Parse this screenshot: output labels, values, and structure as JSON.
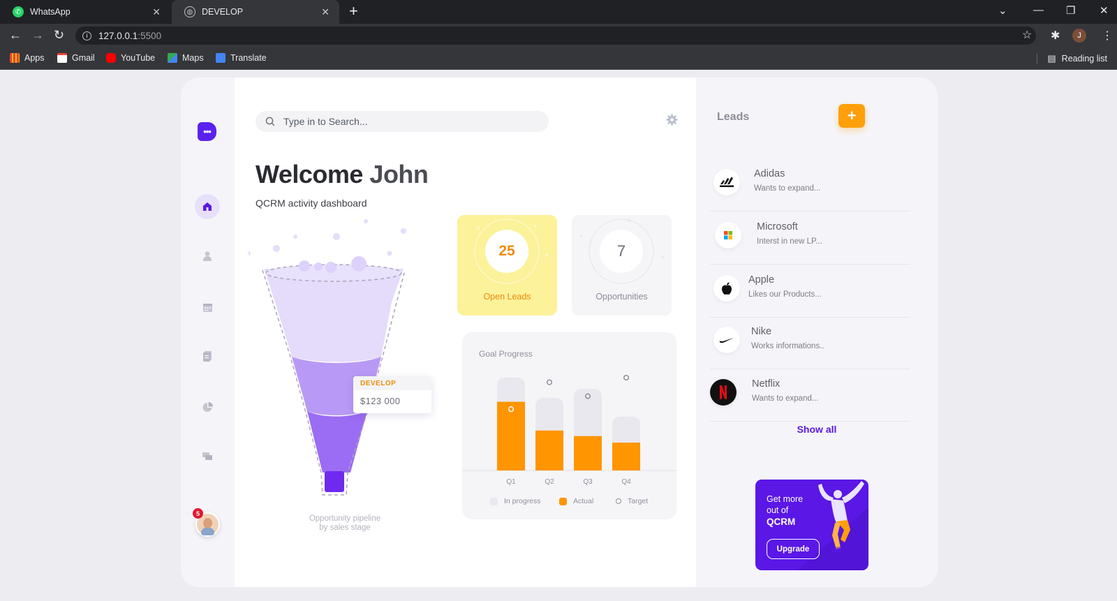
{
  "browser": {
    "tabs": [
      {
        "title": "WhatsApp",
        "active": false
      },
      {
        "title": "DEVELOP",
        "active": true
      }
    ],
    "address": {
      "host": "127.0.0.1",
      "port": ":5500"
    },
    "bookmarks": [
      "Apps",
      "Gmail",
      "YouTube",
      "Maps",
      "Translate"
    ],
    "reading_list": "Reading list",
    "profile_initial": "J"
  },
  "sidebar": {
    "items": [
      "home",
      "contacts",
      "calendar",
      "documents",
      "reports",
      "messages"
    ],
    "notification_count": "5"
  },
  "header": {
    "search_placeholder": "Type in to Search...",
    "welcome_prefix": "Welcome",
    "user_name": "John",
    "subtitle": "QCRM activity dashboard"
  },
  "funnel": {
    "tooltip_stage": "DEVELOP",
    "tooltip_value": "$123 000",
    "caption_line1": "Opportunity pipeline",
    "caption_line2": "by sales stage"
  },
  "kpis": {
    "open_leads": {
      "value": "25",
      "label": "Open Leads"
    },
    "opportunities": {
      "value": "7",
      "label": "Opportunities"
    }
  },
  "goal_progress": {
    "title": "Goal Progress",
    "legend": [
      "In progress",
      "Actual",
      "Target"
    ]
  },
  "chart_data": {
    "type": "bar",
    "title": "Goal Progress",
    "categories": [
      "Q1",
      "Q2",
      "Q3",
      "Q4"
    ],
    "series": [
      {
        "name": "In progress",
        "values": [
          100,
          78,
          88,
          58
        ]
      },
      {
        "name": "Actual",
        "values": [
          74,
          43,
          37,
          30
        ]
      },
      {
        "name": "Target",
        "values": [
          66,
          95,
          80,
          100
        ]
      }
    ],
    "ylim": [
      0,
      100
    ],
    "legend_position": "bottom",
    "colors": {
      "In progress": "#e8e8ee",
      "Actual": "#ff9500",
      "Target": "#8e909b"
    }
  },
  "leads": {
    "title": "Leads",
    "items": [
      {
        "name": "Adidas",
        "desc": "Wants to expand...",
        "icon": "adidas-logo"
      },
      {
        "name": "Microsoft",
        "desc": "Interst in new LP...",
        "icon": "microsoft-logo"
      },
      {
        "name": "Apple",
        "desc": "Likes our Products...",
        "icon": "apple-logo"
      },
      {
        "name": "Nike",
        "desc": "Works informations..",
        "icon": "nike-logo"
      },
      {
        "name": "Netflix",
        "desc": "Wants to expand...",
        "icon": "netflix-logo"
      }
    ],
    "show_all": "Show all"
  },
  "promo": {
    "line1": "Get more out of",
    "brand": "QCRM",
    "button": "Upgrade"
  },
  "colors": {
    "accent": "#5a17e6",
    "orange": "#ff9500",
    "yellow": "#fbf29a"
  }
}
